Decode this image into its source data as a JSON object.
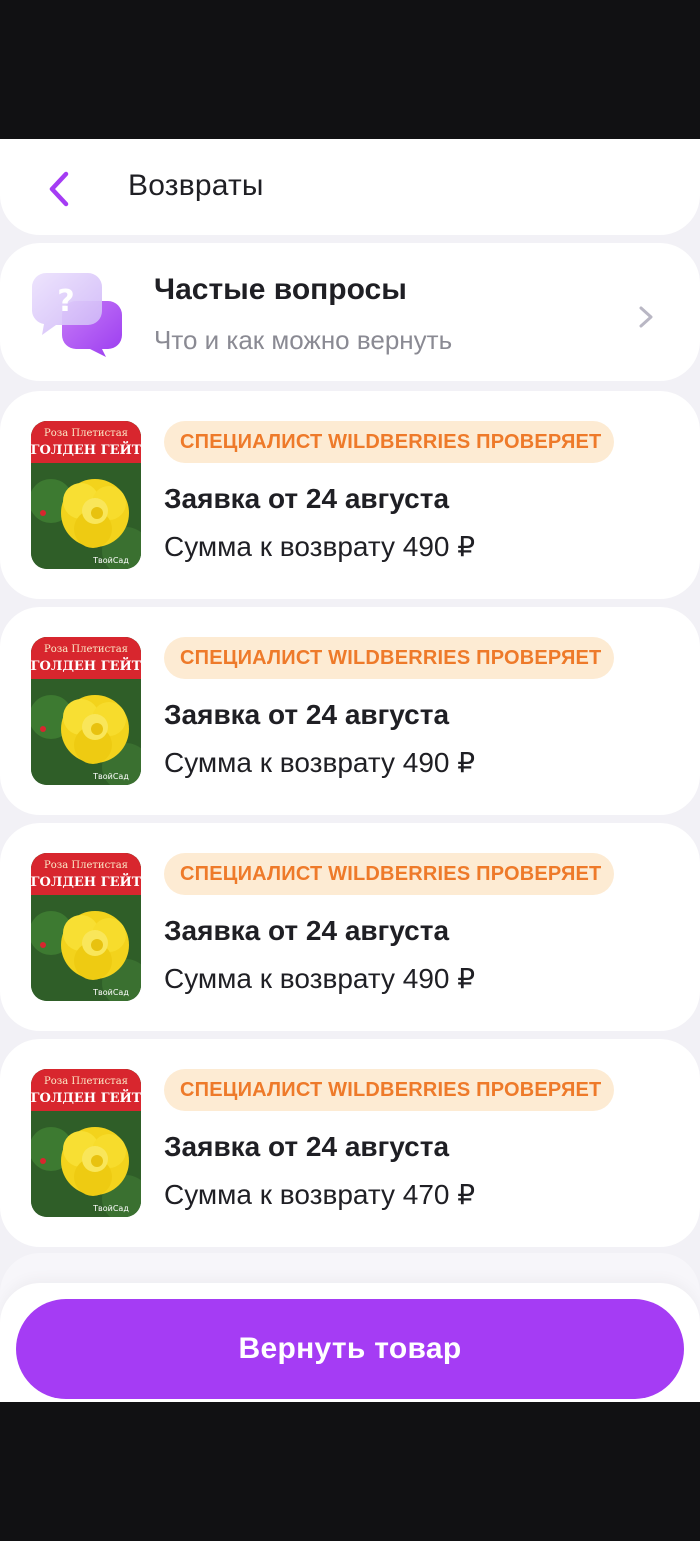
{
  "header": {
    "title": "Возвраты"
  },
  "faq": {
    "title": "Частые вопросы",
    "subtitle": "Что и как можно вернуть"
  },
  "returns": [
    {
      "status": "СПЕЦИАЛИСТ WILDBERRIES ПРОВЕРЯЕТ",
      "title": "Заявка от 24 августа",
      "amount": "Сумма к возврату 490 ₽",
      "product_line1": "Роза Плетистая",
      "product_line2": "ГОЛДЕН ГЕЙТ",
      "brand": "ТвойСад"
    },
    {
      "status": "СПЕЦИАЛИСТ WILDBERRIES ПРОВЕРЯЕТ",
      "title": "Заявка от 24 августа",
      "amount": "Сумма к возврату 490 ₽",
      "product_line1": "Роза Плетистая",
      "product_line2": "ГОЛДЕН ГЕЙТ",
      "brand": "ТвойСад"
    },
    {
      "status": "СПЕЦИАЛИСТ WILDBERRIES ПРОВЕРЯЕТ",
      "title": "Заявка от 24 августа",
      "amount": "Сумма к возврату 490 ₽",
      "product_line1": "Роза Плетистая",
      "product_line2": "ГОЛДЕН ГЕЙТ",
      "brand": "ТвойСад"
    },
    {
      "status": "СПЕЦИАЛИСТ WILDBERRIES ПРОВЕРЯЕТ",
      "title": "Заявка от 24 августа",
      "amount": "Сумма к возврату 470 ₽",
      "product_line1": "Роза Плетистая",
      "product_line2": "ГОЛДЕН ГЕЙТ",
      "brand": "ТвойСад"
    }
  ],
  "actions": {
    "return_button": "Вернуть товар"
  },
  "icons": {
    "back": "chevron-left-icon",
    "faq": "question-chat-icon",
    "faq_arrow": "chevron-right-icon"
  },
  "colors": {
    "accent": "#a53cf4",
    "badge_bg": "#fdebd3",
    "badge_text": "#ee7a2a",
    "background": "#f2f1f6"
  }
}
